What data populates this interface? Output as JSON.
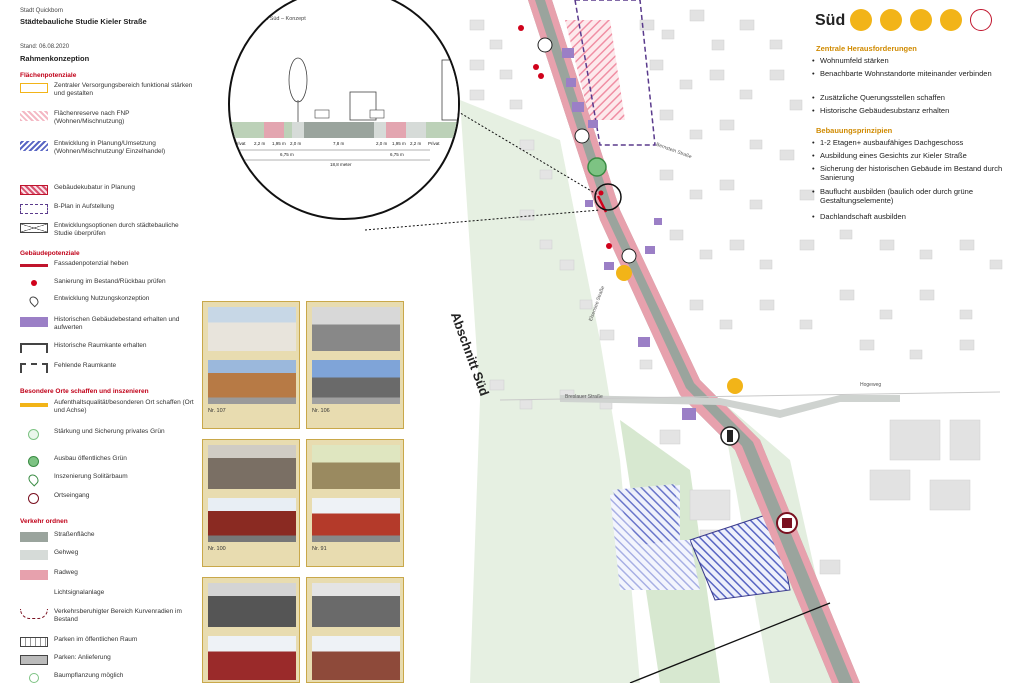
{
  "header": {
    "org": "Stadt Quickborn",
    "study_title": "Städtebauliche Studie Kieler Straße",
    "date": "Stand: 06.08.2020",
    "concept": "Rahmenkonzeption"
  },
  "legend": {
    "sections": [
      {
        "title": "Flächenpotenziale",
        "items": [
          {
            "label": "Zentraler Versorgungsbereich funktional stärken und gestalten",
            "icon": "outline-yellow"
          },
          {
            "label": "Flächenreserve nach FNP (Wohnen/Mischnutzung)",
            "icon": "hatch-pink"
          },
          {
            "label": "Entwicklung in Planung/Umsetzung (Wohnen/Mischnutzung/ Einzelhandel)",
            "icon": "hatch-blue"
          },
          {
            "label": "Gebäudekubatur in Planung",
            "icon": "hatch-pink-dark"
          },
          {
            "label": "B-Plan in Aufstellung",
            "icon": "dashed-purple"
          },
          {
            "label": "Entwicklungsoptionen durch städtebauliche Studie überprüfen",
            "icon": "cross-box"
          }
        ]
      },
      {
        "title": "Gebäudepotenziale",
        "items": [
          {
            "label": "Fassadenpotenzial heben",
            "icon": "red-line"
          },
          {
            "label": "Sanierung im Bestand/Rückbau prüfen",
            "icon": "red-dot"
          },
          {
            "label": "Entwicklung Nutzungskonzeption",
            "icon": "pin"
          },
          {
            "label": "Historischen Gebäudebestand erhalten und aufwerten",
            "icon": "purple-box"
          },
          {
            "label": "Historische Raumkante erhalten",
            "icon": "bracket"
          },
          {
            "label": "Fehlende Raumkante",
            "icon": "bracket-dash"
          }
        ]
      },
      {
        "title": "Besondere Orte schaffen und inszenieren",
        "items": [
          {
            "label": "Aufenthaltsqualität/besonderen Ort schaffen (Ort und Achse)",
            "icon": "yellow-pin-line"
          },
          {
            "label": "Stärkung und Sicherung privates Grün",
            "icon": "green-pin-light"
          },
          {
            "label": "Ausbau öffentliches Grün",
            "icon": "green-circle"
          },
          {
            "label": "Inszenierung Solitärbaum",
            "icon": "green-pin"
          },
          {
            "label": "Ortseingang",
            "icon": "gate"
          }
        ]
      },
      {
        "title": "Verkehr ordnen",
        "items": [
          {
            "label": "Straßenfläche",
            "icon": "grey-dark"
          },
          {
            "label": "Gehweg",
            "icon": "grey-light"
          },
          {
            "label": "Radweg",
            "icon": "pink"
          },
          {
            "label": "Lichtsignalanlage",
            "icon": "signal"
          },
          {
            "label": "Verkehrsberuhigter Bereich Kurvenradien im Bestand",
            "icon": "curve"
          },
          {
            "label": "Parken im öffentlichen Raum",
            "icon": "parking"
          },
          {
            "label": "Parken: Anlieferung",
            "icon": "parking2"
          },
          {
            "label": "Baumpflanzung möglich",
            "icon": "tree"
          }
        ]
      }
    ]
  },
  "photos": [
    {
      "nr": "Nr. 107"
    },
    {
      "nr": "Nr. 106"
    },
    {
      "nr": "Nr. 100"
    },
    {
      "nr": "Nr. 91"
    }
  ],
  "section_diagram": {
    "title": "Querschnitt Süd – Konzept",
    "dims": [
      "2,2 m",
      "1,95 m",
      "2,0 m",
      "7,8 m",
      "2,0 m",
      "1,95 m",
      "2,2 m"
    ],
    "labels": [
      "Privat",
      "Privat"
    ],
    "width_total": "18,8 meter",
    "sub_a": "6,75 m",
    "sub_b": "6,75 m"
  },
  "map": {
    "section_label": "Abschnitt Süd",
    "street_labels": [
      "Breslauer Straße",
      "Bernstein Straße",
      "Elsensee Straße",
      "Hogeweg"
    ]
  },
  "right": {
    "title": "Süd",
    "challenges_title": "Zentrale Herausforderungen",
    "challenges": [
      "Wohnumfeld stärken",
      "Benachbarte Wohnstandorte miteinander verbinden",
      "Zusätzliche Querungsstellen schaffen",
      "Historische Gebäudesubstanz erhalten"
    ],
    "principles_title": "Bebauungsprinzipien",
    "principles": [
      "1-2 Etagen+ ausbaufähiges Dachgeschoss",
      "Ausbildung eines Gesichts zur Kieler Straße",
      "Sicherung der historischen Gebäude im Bestand durch Sanierung",
      "Bauflucht ausbilden (baulich oder durch grüne Gestaltungselemente)",
      "Dachlandschaft ausbilden"
    ],
    "badge_colors": [
      "#f2b418",
      "#f2b418",
      "#f2b418",
      "#f2b418",
      "#c0142c"
    ]
  },
  "colors": {
    "accent": "#f2b418",
    "red": "#c00018",
    "road": "#8e9a92",
    "green": "#dcebd6",
    "purple": "#9b7fc6",
    "blue_hatch": "#6270c8"
  }
}
